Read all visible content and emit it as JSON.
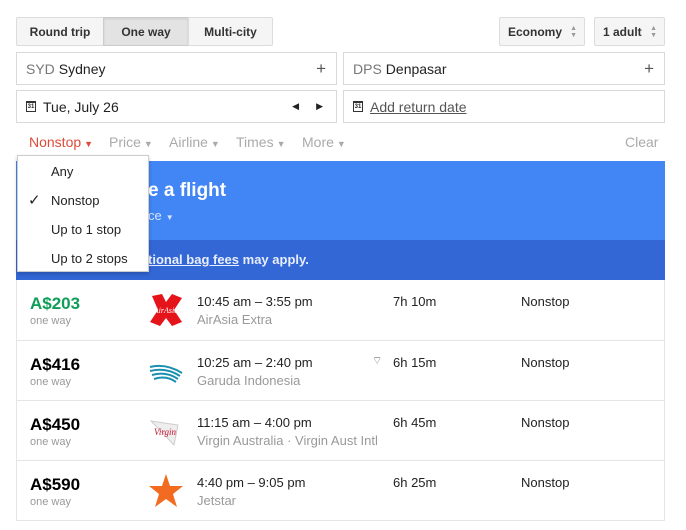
{
  "trip_types": [
    {
      "label": "Round trip"
    },
    {
      "label": "One way",
      "active": true
    },
    {
      "label": "Multi-city"
    }
  ],
  "cabin": "Economy",
  "passengers": "1 adult",
  "origin": {
    "code": "SYD",
    "city": "Sydney"
  },
  "destination": {
    "code": "DPS",
    "city": "Denpasar"
  },
  "date": {
    "value": "Tue, July 26",
    "return_placeholder": "Add return date",
    "calendar_glyph": "31"
  },
  "filters": {
    "stops": "Nonstop",
    "price": "Price",
    "airline": "Airline",
    "times": "Times",
    "more": "More",
    "clear": "Clear",
    "active_color": "#dd4b39"
  },
  "banner": {
    "title_fragment": "e a flight",
    "sort_fragment": "ce",
    "note_link_fragment": "tional bag fees",
    "note_rest": " may apply.",
    "color": "#4285f4",
    "band_color": "#3367d6"
  },
  "stops_menu": {
    "options": [
      "Any",
      "Nonstop",
      "Up to 1 stop",
      "Up to 2 stops"
    ],
    "selected": "Nonstop"
  },
  "flights": [
    {
      "price": "A$203",
      "price_note": "one way",
      "times": "10:45 am – 3:55 pm",
      "airline": "AirAsia Extra",
      "duration": "7h 10m",
      "stops": "Nonstop",
      "cheapest": true,
      "logo": "airasia-logo",
      "wifi": false
    },
    {
      "price": "A$416",
      "price_note": "one way",
      "times": "10:25 am – 2:40 pm",
      "airline": "Garuda Indonesia",
      "duration": "6h 15m",
      "stops": "Nonstop",
      "logo": "garuda-logo",
      "wifi": true
    },
    {
      "price": "A$450",
      "price_note": "one way",
      "times": "11:15 am – 4:00 pm",
      "airline": "Virgin Australia · Virgin Aust Intl",
      "duration": "6h 45m",
      "stops": "Nonstop",
      "logo": "virgin-logo",
      "wifi": false
    },
    {
      "price": "A$590",
      "price_note": "one way",
      "times": "4:40 pm – 9:05 pm",
      "airline": "Jetstar",
      "duration": "6h 25m",
      "stops": "Nonstop",
      "logo": "jetstar-logo",
      "wifi": false
    }
  ]
}
